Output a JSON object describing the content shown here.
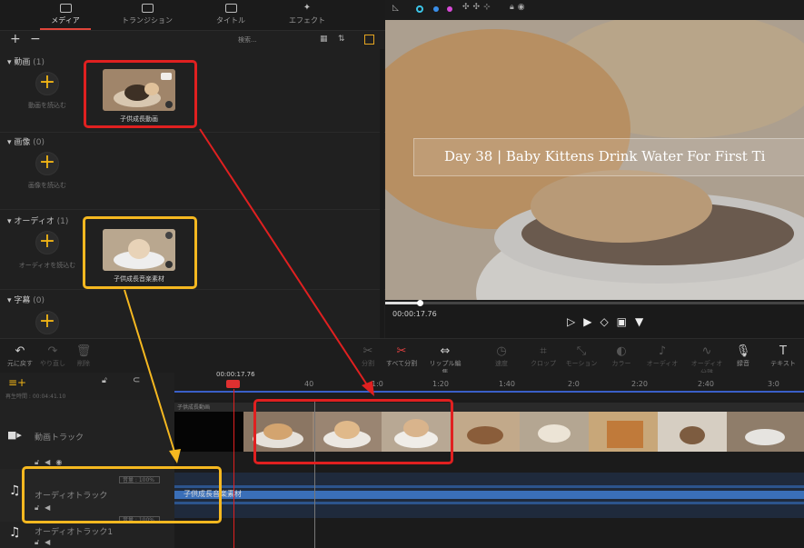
{
  "tabs": [
    {
      "label": "メディア",
      "active": true
    },
    {
      "label": "トランジション"
    },
    {
      "label": "タイトル"
    },
    {
      "label": "エフェクト"
    }
  ],
  "toolbar": {
    "add": "+",
    "remove": "−",
    "search_placeholder": "検索..."
  },
  "sections": {
    "video": {
      "title": "動画",
      "count": "(1)",
      "add_label": "動画を読込む",
      "item_label": "子供成長動画"
    },
    "image": {
      "title": "画像",
      "count": "(0)",
      "add_label": "画像を読込む"
    },
    "audio": {
      "title": "オーディオ",
      "count": "(1)",
      "add_label": "オーディオを読込む",
      "item_label": "子供成長音楽素材"
    },
    "subtitle": {
      "title": "字幕",
      "count": "(0)"
    }
  },
  "preview": {
    "caption": "Day 38 | Baby Kittens Drink Water For First Ti",
    "time": "00:00:17.76",
    "progress": 0.08
  },
  "edit_toolbar": [
    {
      "label": "元に戻す",
      "icon": "undo-icon",
      "g": "↶"
    },
    {
      "label": "やり直し",
      "icon": "redo-icon",
      "g": "↷",
      "dim": true
    },
    {
      "label": "削除",
      "icon": "trash-icon",
      "g": "🗑",
      "dim": true
    },
    {
      "label": "分割",
      "icon": "scissors-icon",
      "g": "✂",
      "dim": true
    },
    {
      "label": "すべて分割",
      "icon": "split-all-icon",
      "g": "✂"
    },
    {
      "label": "リップル編集",
      "icon": "ripple-icon",
      "g": "⇔"
    },
    {
      "label": "速度",
      "icon": "speed-icon",
      "g": "◷",
      "dim": true
    },
    {
      "label": "クロップ",
      "icon": "crop-icon",
      "g": "⌗",
      "dim": true
    },
    {
      "label": "モーション",
      "icon": "motion-icon",
      "g": "⤡",
      "dim": true
    },
    {
      "label": "カラー",
      "icon": "palette-icon",
      "g": "◐",
      "dim": true
    },
    {
      "label": "オーディオ",
      "icon": "audio-icon",
      "g": "♪",
      "dim": true
    },
    {
      "label": "オーディオ分離",
      "icon": "audio-split-icon",
      "g": "∿",
      "dim": true
    },
    {
      "label": "録音",
      "icon": "mic-icon",
      "g": "🎙"
    },
    {
      "label": "テキスト",
      "icon": "text-icon",
      "g": "T"
    }
  ],
  "timeline": {
    "playhead_time": "00:00:17.76",
    "duration_label": "再生時間 : 00:04:41.10",
    "ticks": [
      "40",
      "1:0",
      "1:20",
      "1:40",
      "2:0",
      "2:20",
      "2:40",
      "3:0"
    ],
    "video_track": "動画トラック",
    "video_clip": "子供成長動画",
    "audio_track": "オーディオトラック",
    "audio_track2": "オーディオトラック1",
    "audio_clip": "子供成長音楽素材",
    "volume": "音量 : 100%"
  },
  "colors": {
    "accent": "#f0b416",
    "highlight_red": "#e02020",
    "highlight_yellow": "#f5b820",
    "wave": "#3a6fb8"
  }
}
